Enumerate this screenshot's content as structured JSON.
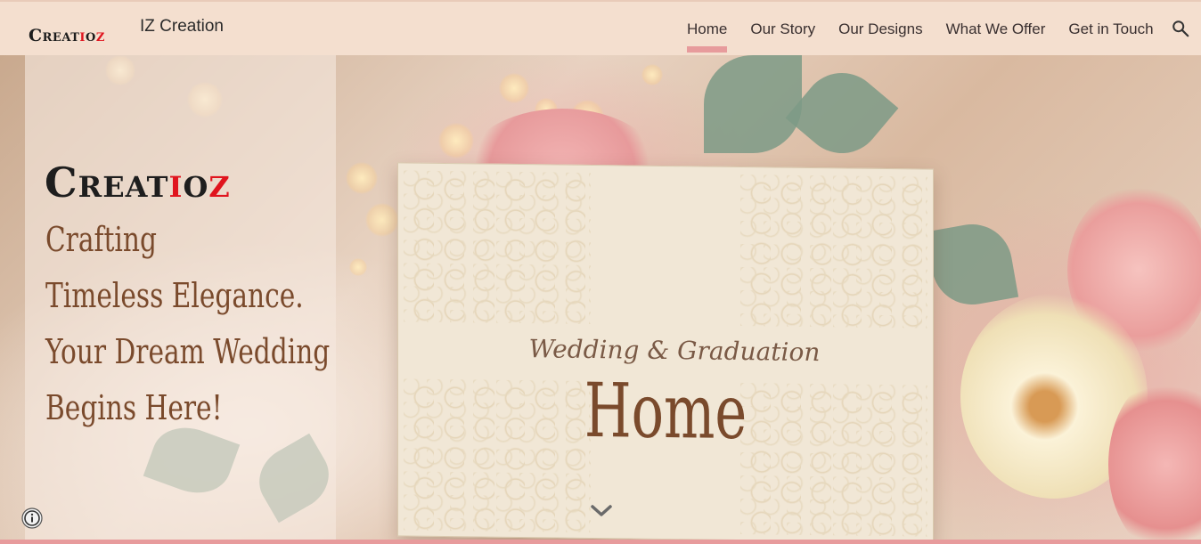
{
  "header": {
    "logo_text_dark_1": "Creat",
    "logo_text_red_1": "i",
    "logo_text_dark_2": "o",
    "logo_text_red_2": "z",
    "site_name": "IZ Creation",
    "nav": [
      {
        "label": "Home",
        "active": true
      },
      {
        "label": "Our Story",
        "active": false
      },
      {
        "label": "Our Designs",
        "active": false
      },
      {
        "label": "What We Offer",
        "active": false
      },
      {
        "label": "Get in Touch",
        "active": false
      }
    ],
    "search_icon": "search-icon"
  },
  "hero": {
    "logo_text_dark_1": "Creat",
    "logo_text_red_1": "i",
    "logo_text_dark_2": "o",
    "logo_text_red_2": "z",
    "tagline_lines": [
      "Crafting",
      "Timeless Elegance.",
      "Your Dream Wedding",
      "Begins Here!"
    ],
    "card_script": "Wedding & Graduation",
    "card_title": "Home",
    "scroll_icon": "chevron-down-icon",
    "info_icon": "info-icon"
  },
  "colors": {
    "header_bg": "#f4dfcf",
    "accent": "#e79b9c",
    "brand_red": "#e0141e",
    "tagline_brown": "#7a4a2c"
  }
}
